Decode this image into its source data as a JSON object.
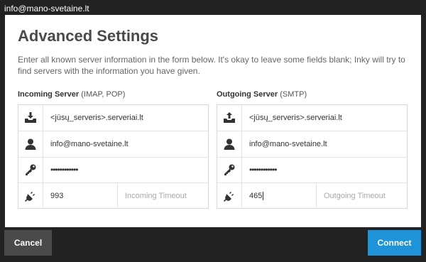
{
  "window": {
    "title": "info@mano-svetaine.lt"
  },
  "dialog": {
    "title": "Advanced Settings",
    "description": "Enter all known server information in the form below. It's okay to leave some fields blank; Inky will try to find servers with the information you have given."
  },
  "incoming": {
    "label_bold": "Incoming Server",
    "label_rest": " (IMAP, POP)",
    "server": "<jūsų_serveris>.serveriai.lt",
    "username": "info@mano-svetaine.lt",
    "password": "••••••••••••",
    "port": "993",
    "timeout_placeholder": "Incoming Timeout"
  },
  "outgoing": {
    "label_bold": "Outgoing Server",
    "label_rest": " (SMTP)",
    "server": "<jūsų_serveris>.serveriai.lt",
    "username": "info@mano-svetaine.lt",
    "password": "••••••••••••",
    "port": "465",
    "timeout_placeholder": "Outgoing Timeout"
  },
  "buttons": {
    "cancel": "Cancel",
    "connect": "Connect"
  },
  "colors": {
    "background": "#222222",
    "accent": "#1e93d8",
    "cancel": "#4a4a4a"
  },
  "icons": [
    "inbox-download-icon",
    "outbox-upload-icon",
    "user-icon",
    "key-icon",
    "plug-icon"
  ]
}
